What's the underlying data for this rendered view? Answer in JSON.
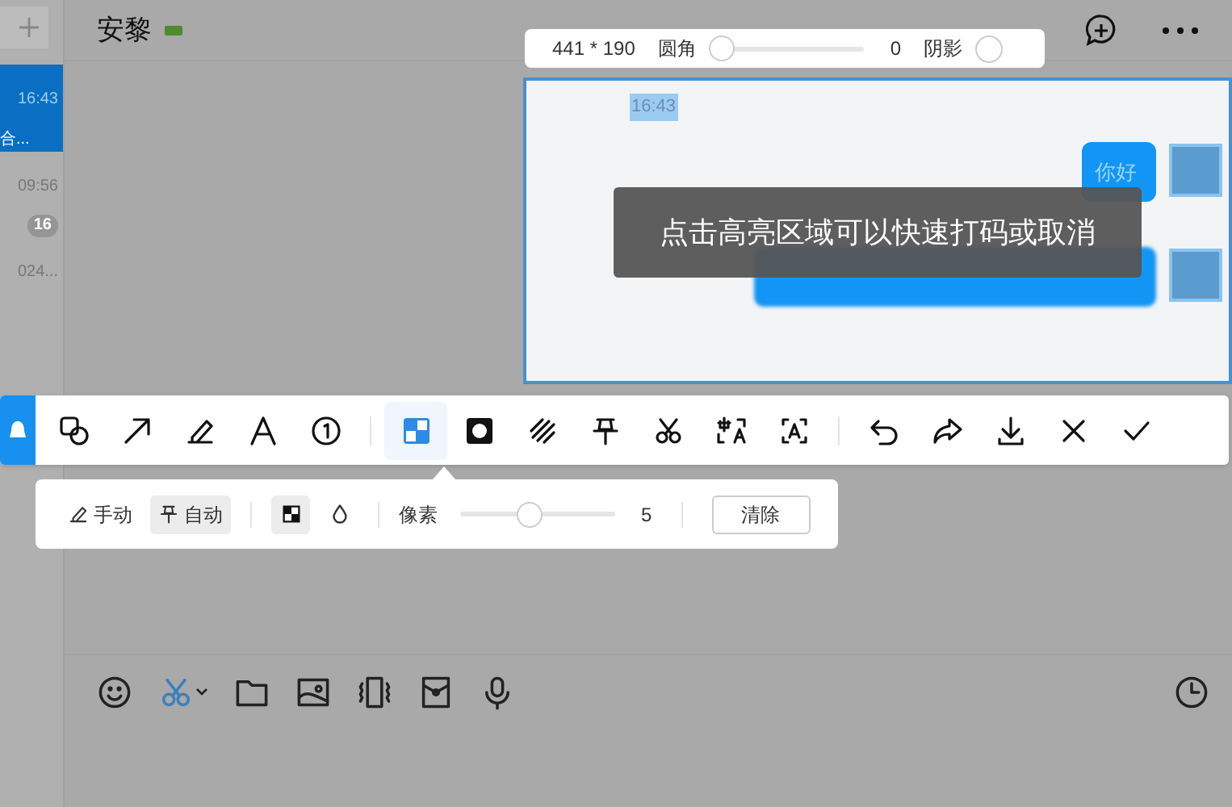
{
  "header": {
    "title": "安黎"
  },
  "sidebar": {
    "items": [
      {
        "time": "16:43",
        "preview": "合...",
        "selected": true
      },
      {
        "time": "09:56",
        "badge": "16",
        "selected": false
      },
      {
        "time": "024...",
        "selected": false
      }
    ]
  },
  "capture": {
    "size": "441 * 190",
    "radius_label": "圆角",
    "radius": {
      "level": 0
    },
    "radius_value": "0",
    "shadow_label": "阴影",
    "shadow": {
      "on": false
    },
    "timestamp": "16:43",
    "messages": [
      {
        "text": "你好",
        "blurred": false
      },
      {
        "blurred": true
      }
    ],
    "hint": "点击高亮区域可以快速打码或取消"
  },
  "toolbar": {
    "groups": [
      [
        {
          "kind": "shape",
          "selected": false
        },
        {
          "kind": "arrow",
          "selected": false
        },
        {
          "kind": "pen",
          "selected": false
        },
        {
          "kind": "text",
          "selected": false
        },
        {
          "kind": "number",
          "selected": false
        }
      ],
      [
        {
          "kind": "mosaic",
          "selected": true
        },
        {
          "kind": "spotlight",
          "selected": false
        },
        {
          "kind": "hatch",
          "selected": false
        },
        {
          "kind": "pin",
          "selected": false
        },
        {
          "kind": "cut",
          "selected": false
        },
        {
          "kind": "translate",
          "selected": false
        },
        {
          "kind": "ocr",
          "selected": false
        }
      ],
      [
        {
          "kind": "undo",
          "selected": false
        },
        {
          "kind": "redo",
          "selected": false
        },
        {
          "kind": "download",
          "selected": false
        },
        {
          "kind": "close",
          "selected": false
        },
        {
          "kind": "confirm",
          "selected": false
        }
      ]
    ]
  },
  "mosaic_options": {
    "modes": [
      {
        "kind": "pen",
        "label": "手动",
        "selected": false
      },
      {
        "kind": "pin",
        "label": "自动",
        "selected": true
      }
    ],
    "styles": [
      {
        "kind": "checker",
        "selected": true
      },
      {
        "kind": "drop",
        "selected": false
      }
    ],
    "size_label": "像素",
    "size": {
      "level": 0.44
    },
    "size_value": "5",
    "clear_button": "清除"
  },
  "input_toolbar": [
    {
      "kind": "emoji"
    },
    {
      "kind": "cut"
    },
    {
      "kind": "folder"
    },
    {
      "kind": "image"
    },
    {
      "kind": "vibrate"
    },
    {
      "kind": "envelope"
    },
    {
      "kind": "mic"
    }
  ]
}
